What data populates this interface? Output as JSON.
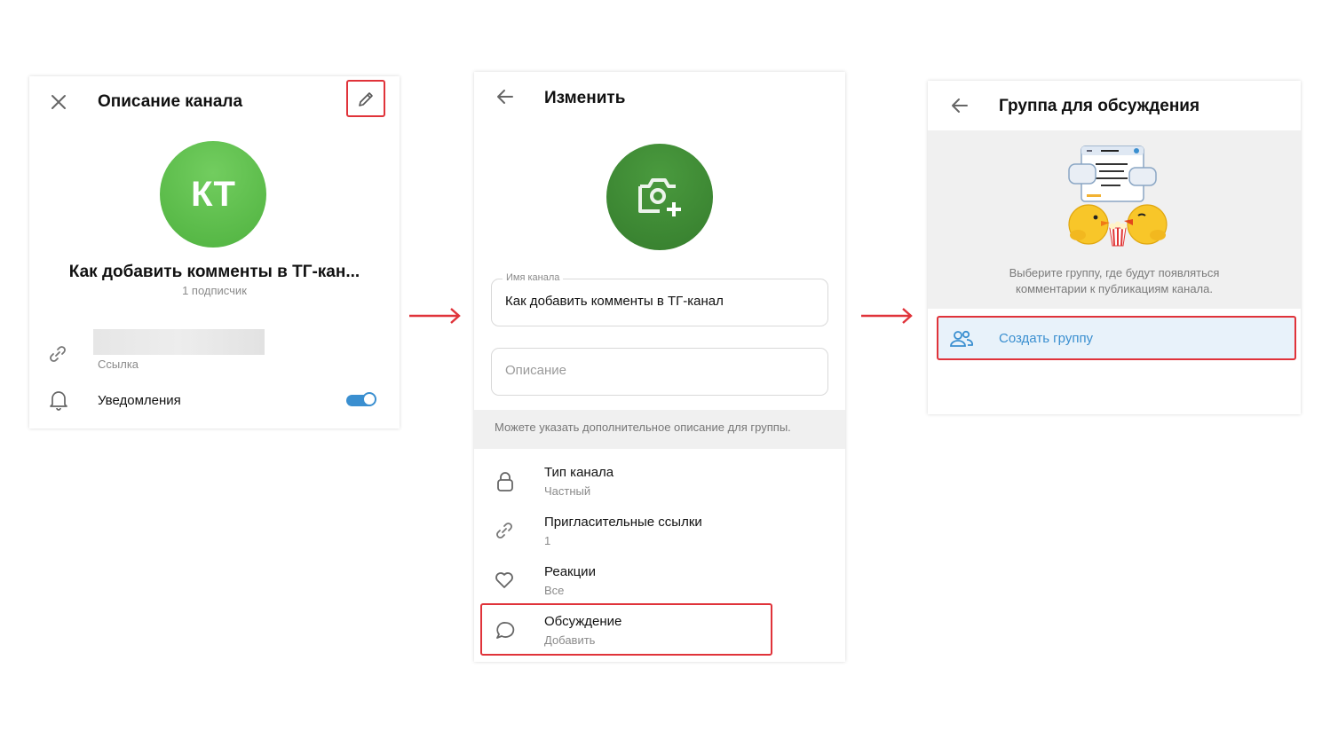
{
  "panel1": {
    "title": "Описание канала",
    "avatar_initials": "КТ",
    "channel_name": "Как добавить комменты в ТГ-кан...",
    "subscribers": "1 подписчик",
    "link_label": "Ссылка",
    "notifications_label": "Уведомления",
    "notifications_on": true
  },
  "panel2": {
    "title": "Изменить",
    "name_field_label": "Имя канала",
    "name_field_value": "Как добавить комменты в ТГ-канал",
    "description_placeholder": "Описание",
    "hint": "Можете указать дополнительное описание для группы.",
    "settings": [
      {
        "title": "Тип канала",
        "value": "Частный",
        "icon": "lock-icon"
      },
      {
        "title": "Пригласительные ссылки",
        "value": "1",
        "icon": "link-icon"
      },
      {
        "title": "Реакции",
        "value": "Все",
        "icon": "heart-icon"
      },
      {
        "title": "Обсуждение",
        "value": "Добавить",
        "icon": "chat-bubble-icon"
      }
    ]
  },
  "panel3": {
    "title": "Группа для обсуждения",
    "description_line1": "Выберите группу, где будут появляться",
    "description_line2": "комментарии к публикациям канала.",
    "create_group_label": "Создать группу"
  },
  "colors": {
    "accent": "#3a8fd0",
    "highlight": "#e0333a",
    "avatar_green": "#5cbc4b",
    "avatar_dark_green": "#3f8e37",
    "section_gray": "#f0f0f0"
  }
}
